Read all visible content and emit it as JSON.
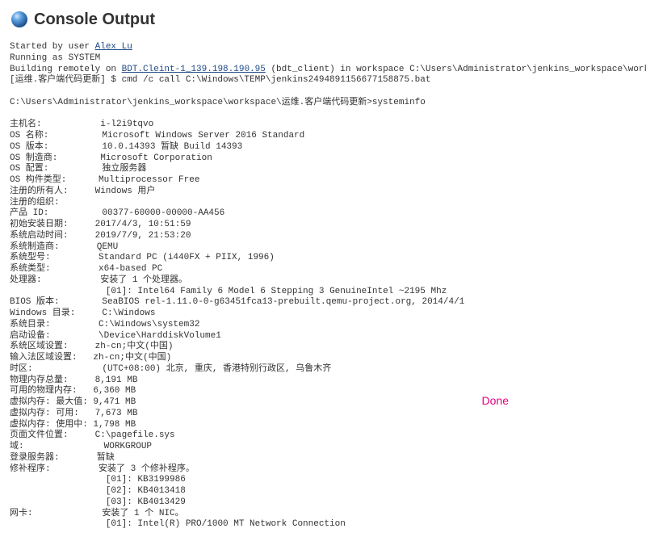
{
  "header": {
    "title": "Console Output"
  },
  "done_label": "Done",
  "links": {
    "user": "Alex Lu",
    "node": "BDT.Cleint-1_139.198.190.95"
  },
  "lines": {
    "l1a": "Started by user ",
    "l2": "Running as SYSTEM",
    "l3a": "Building remotely on ",
    "l3b": " (bdt_client) in workspace C:\\Users\\Administrator\\jenkins_workspace\\workspace\\运维.客户端代码更新",
    "l4": "[运维.客户端代码更新] $ cmd /c call C:\\Windows\\TEMP\\jenkins2494891156677158875.bat",
    "l5": "",
    "l6": "C:\\Users\\Administrator\\jenkins_workspace\\workspace\\运维.客户端代码更新>systeminfo",
    "l7": "",
    "l8": "主机名:           i-l2i9tqvo",
    "l9": "OS 名称:          Microsoft Windows Server 2016 Standard",
    "l10": "OS 版本:          10.0.14393 暂缺 Build 14393",
    "l11": "OS 制造商:        Microsoft Corporation",
    "l12": "OS 配置:          独立服务器",
    "l13": "OS 构件类型:      Multiprocessor Free",
    "l14": "注册的所有人:     Windows 用户",
    "l15": "注册的组织:       ",
    "l16": "产品 ID:          00377-60000-00000-AA456",
    "l17": "初始安装日期:     2017/4/3, 10:51:59",
    "l18": "系统启动时间:     2019/7/9, 21:53:20",
    "l19": "系统制造商:       QEMU",
    "l20": "系统型号:         Standard PC (i440FX + PIIX, 1996)",
    "l21": "系统类型:         x64-based PC",
    "l22": "处理器:           安装了 1 个处理器。",
    "l23": "                  [01]: Intel64 Family 6 Model 6 Stepping 3 GenuineIntel ~2195 Mhz",
    "l24": "BIOS 版本:        SeaBIOS rel-1.11.0-0-g63451fca13-prebuilt.qemu-project.org, 2014/4/1",
    "l25": "Windows 目录:     C:\\Windows",
    "l26": "系统目录:         C:\\Windows\\system32",
    "l27": "启动设备:         \\Device\\HarddiskVolume1",
    "l28": "系统区域设置:     zh-cn;中文(中国)",
    "l29": "输入法区域设置:   zh-cn;中文(中国)",
    "l30": "时区:             (UTC+08:00) 北京, 重庆, 香港特别行政区, 乌鲁木齐",
    "l31": "物理内存总量:     8,191 MB",
    "l32": "可用的物理内存:   6,360 MB",
    "l33": "虚拟内存: 最大值: 9,471 MB",
    "l34": "虚拟内存: 可用:   7,673 MB",
    "l35": "虚拟内存: 使用中: 1,798 MB",
    "l36": "页面文件位置:     C:\\pagefile.sys",
    "l37": "域:               WORKGROUP",
    "l38": "登录服务器:       暂缺",
    "l39": "修补程序:         安装了 3 个修补程序。",
    "l40": "                  [01]: KB3199986",
    "l41": "                  [02]: KB4013418",
    "l42": "                  [03]: KB4013429",
    "l43": "网卡:             安装了 1 个 NIC。",
    "l44": "                  [01]: Intel(R) PRO/1000 MT Network Connection"
  }
}
